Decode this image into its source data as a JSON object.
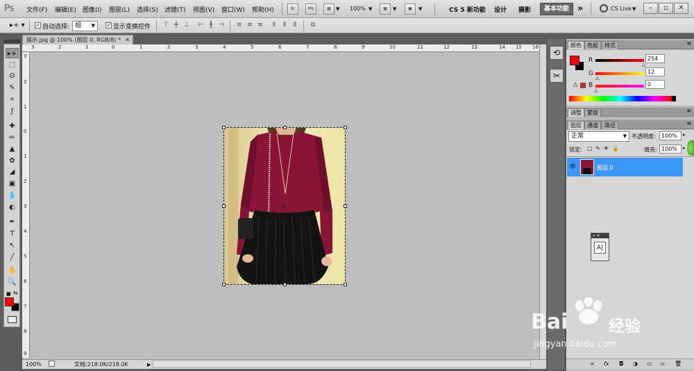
{
  "app": {
    "logo": "Ps"
  },
  "menu": [
    "文件(F)",
    "编辑(E)",
    "图像(I)",
    "图层(L)",
    "选择(S)",
    "滤镜(T)",
    "视图(V)",
    "窗口(W)",
    "帮助(H)"
  ],
  "menubar_tools": {
    "br": "Br",
    "mb": "Mb",
    "zoom": "100%"
  },
  "workspaces": [
    "CS 5 新功能",
    "设计",
    "摄影",
    "基本功能"
  ],
  "workspace_active": "基本功能",
  "more_label": "»",
  "cs_live": "CS Live",
  "window_buttons": [
    "–",
    "▫",
    "✕"
  ],
  "options": {
    "auto_select_label": "自动选择:",
    "auto_select_value": "组",
    "show_transform_label": "显示变换控件"
  },
  "document": {
    "tab_title": "展示.jpg @ 100% (图层 0, RGB/8) *",
    "zoom": "100%",
    "doc_info": "文档:218.0K/218.0K",
    "h_ruler_labels": [
      "3",
      "2",
      "1",
      "0",
      "1",
      "2",
      "3",
      "4",
      "5",
      "6",
      "7",
      "8",
      "9",
      "10",
      "11",
      "12",
      "13",
      "14",
      "15",
      "16"
    ],
    "v_ruler_labels": [
      "3",
      "2",
      "1",
      "0",
      "1",
      "2",
      "3",
      "4",
      "5",
      "6",
      "7",
      "8",
      "9"
    ]
  },
  "tools": [
    "move-tool-icon",
    "marquee-tool-icon",
    "lasso-tool-icon",
    "quick-select-tool-icon",
    "crop-tool-icon",
    "eyedropper-tool-icon",
    "healing-brush-icon",
    "brush-tool-icon",
    "clone-stamp-icon",
    "history-brush-icon",
    "eraser-tool-icon",
    "gradient-tool-icon",
    "blur-tool-icon",
    "dodge-tool-icon",
    "pen-tool-icon",
    "type-tool-icon",
    "path-select-icon",
    "shape-tool-icon",
    "hand-tool-icon",
    "zoom-tool-icon"
  ],
  "tool_glyphs": [
    "▸+",
    "⬚",
    "ʘ",
    "✎",
    "⌗",
    "ƒ",
    "✚",
    "✏",
    "▲",
    "✿",
    "◢",
    "▣",
    "💧",
    "◐",
    "✒",
    "T",
    "↖",
    "╱",
    "✋",
    "🔍"
  ],
  "colors": {
    "foreground": "#ff0000",
    "background": "#000000",
    "selection_blue": "#3d97f7"
  },
  "color_panel": {
    "tabs": [
      "颜色",
      "色板",
      "样式"
    ],
    "r_label": "R",
    "r_value": "254",
    "g_label": "G",
    "g_value": "12",
    "b_label": "B",
    "b_value": "0"
  },
  "adjust_panel": {
    "tabs": [
      "调整",
      "蒙版"
    ]
  },
  "layers_panel": {
    "tabs": [
      "图层",
      "通道",
      "路径"
    ],
    "blend_mode": "正常",
    "opacity_label": "不透明度:",
    "opacity_value": "100%",
    "lock_label": "锁定:",
    "fill_label": "填充:",
    "fill_value": "100%",
    "layer_name": "图层 0"
  },
  "layers_footer_icons": [
    "∞",
    "fx",
    "◘",
    "◑",
    "▭",
    "▫",
    "🗑"
  ],
  "float_panel": {
    "label": "A|"
  },
  "watermark": {
    "brand": "Bai",
    "brand2": "经验",
    "url": "jingyan.baidu.com"
  }
}
